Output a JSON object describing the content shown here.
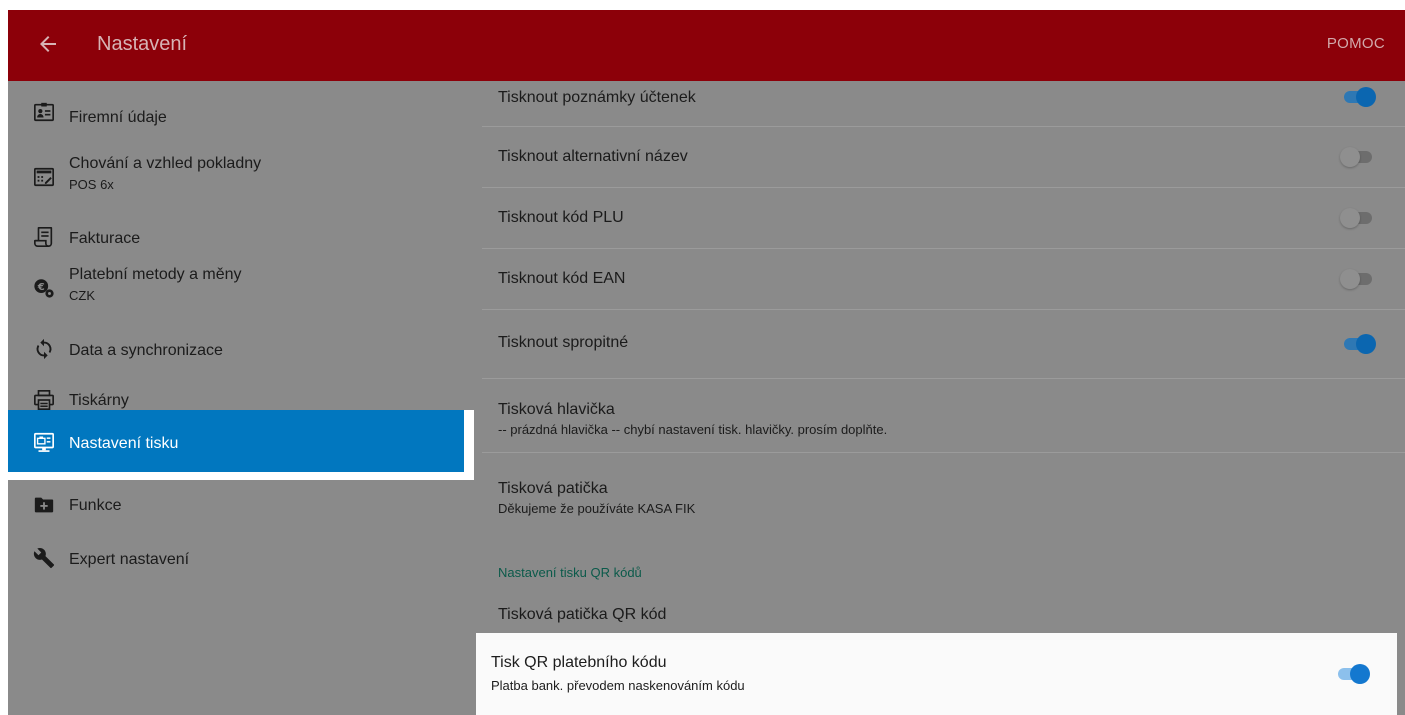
{
  "appbar": {
    "title": "Nastavení",
    "help_label": "POMOC",
    "color": "#8c0009"
  },
  "sidebar": {
    "items": [
      {
        "label": "Firemní údaje",
        "icon": "company-card-icon"
      },
      {
        "label": "Chování a vzhled pokladny",
        "sublabel": "POS 6x",
        "icon": "cash-register-icon"
      },
      {
        "label": "Fakturace",
        "icon": "invoice-icon"
      },
      {
        "label": "Platební metody a měny",
        "sublabel": "CZK",
        "icon": "currency-settings-icon"
      },
      {
        "label": "Data a synchronizace",
        "icon": "sync-icon"
      },
      {
        "label": "Tiskárny",
        "icon": "printer-icon"
      },
      {
        "label": "Nastavení tisku",
        "icon": "print-settings-icon",
        "active": true
      },
      {
        "label": "Funkce",
        "icon": "folder-plus-icon"
      },
      {
        "label": "Expert nastavení",
        "icon": "wrench-icon"
      }
    ]
  },
  "settings": {
    "rows": [
      {
        "label": "Tisknout poznámky účtenek",
        "toggle": "on"
      },
      {
        "label": "Tisknout alternativní název",
        "toggle": "off"
      },
      {
        "label": "Tisknout kód PLU",
        "toggle": "off"
      },
      {
        "label": "Tisknout kód EAN",
        "toggle": "off"
      },
      {
        "label": "Tisknout spropitné",
        "toggle": "on"
      },
      {
        "label": "Tisková hlavička",
        "summary": "-- prázdná hlavička -- chybí nastavení tisk. hlavičky. prosím doplňte."
      },
      {
        "label": "Tisková patička",
        "summary": "Děkujeme že používáte KASA FIK"
      }
    ],
    "qr_section": {
      "title": "Nastavení tisku QR kódů",
      "footer_label": "Tisková patička QR kód",
      "payment_label": "Tisk QR platebního kódu",
      "payment_summary": "Platba bank. převodem naskenováním kódu",
      "payment_toggle": "on"
    }
  },
  "colors": {
    "active_nav": "#0177bf",
    "toggle_on": "#0b66b0",
    "section_title": "#0b5a4a"
  }
}
